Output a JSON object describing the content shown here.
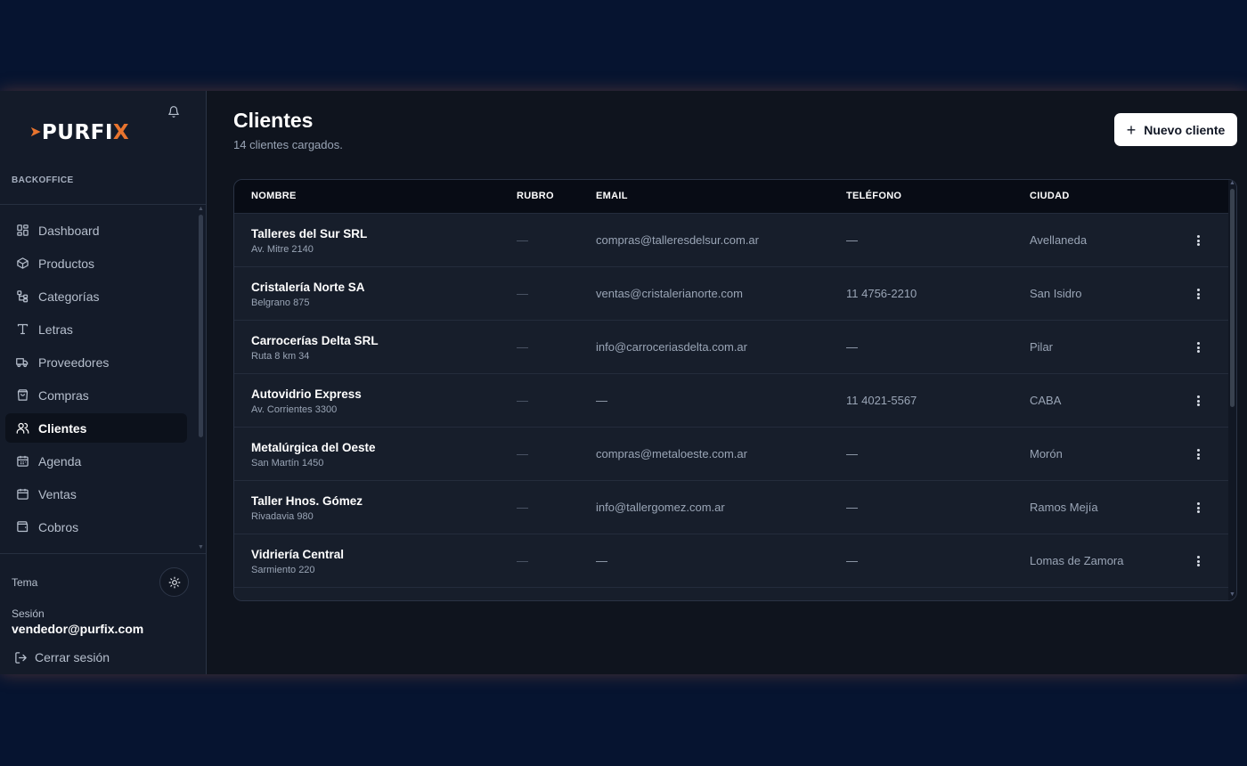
{
  "sidebar": {
    "logo": {
      "prefix": "PURFI",
      "suffix": "X"
    },
    "brand_subtitle": "BACKOFFICE",
    "items": [
      {
        "label": "Dashboard",
        "icon": "dashboard-icon",
        "active": false
      },
      {
        "label": "Productos",
        "icon": "box-icon",
        "active": false
      },
      {
        "label": "Categorías",
        "icon": "categories-icon",
        "active": false
      },
      {
        "label": "Letras",
        "icon": "type-icon",
        "active": false
      },
      {
        "label": "Proveedores",
        "icon": "truck-icon",
        "active": false
      },
      {
        "label": "Compras",
        "icon": "shopping-bag-icon",
        "active": false
      },
      {
        "label": "Clientes",
        "icon": "users-icon",
        "active": true
      },
      {
        "label": "Agenda",
        "icon": "calendar-icon",
        "active": false
      },
      {
        "label": "Ventas",
        "icon": "calendar-icon",
        "active": false
      },
      {
        "label": "Cobros",
        "icon": "wallet-icon",
        "active": false
      }
    ],
    "theme_label": "Tema",
    "session_label": "Sesión",
    "session_user": "vendedor@purfix.com",
    "logout_label": "Cerrar sesión"
  },
  "header": {
    "title": "Clientes",
    "subtitle": "14 clientes cargados.",
    "new_button_label": "Nuevo cliente"
  },
  "table": {
    "columns": [
      "NOMBRE",
      "RUBRO",
      "EMAIL",
      "TELÉFONO",
      "CIUDAD"
    ],
    "rows": [
      {
        "name": "Talleres del Sur SRL",
        "address": "Av. Mitre 2140",
        "rubro": "—",
        "email": "compras@talleresdelsur.com.ar",
        "phone": "—",
        "city": "Avellaneda"
      },
      {
        "name": "Cristalería Norte SA",
        "address": "Belgrano 875",
        "rubro": "—",
        "email": "ventas@cristalerianorte.com",
        "phone": "11 4756-2210",
        "city": "San Isidro"
      },
      {
        "name": "Carrocerías Delta SRL",
        "address": "Ruta 8 km 34",
        "rubro": "—",
        "email": "info@carroceriasdelta.com.ar",
        "phone": "—",
        "city": "Pilar"
      },
      {
        "name": "Autovidrio Express",
        "address": "Av. Corrientes 3300",
        "rubro": "—",
        "email": "—",
        "phone": "11 4021-5567",
        "city": "CABA"
      },
      {
        "name": "Metalúrgica del Oeste",
        "address": "San Martín 1450",
        "rubro": "—",
        "email": "compras@metaloeste.com.ar",
        "phone": "—",
        "city": "Morón"
      },
      {
        "name": "Taller Hnos. Gómez",
        "address": "Rivadavia 980",
        "rubro": "—",
        "email": "info@tallergomez.com.ar",
        "phone": "—",
        "city": "Ramos Mejía"
      },
      {
        "name": "Vidriería Central",
        "address": "Sarmiento 220",
        "rubro": "—",
        "email": "—",
        "phone": "—",
        "city": "Lomas de Zamora"
      }
    ]
  },
  "colors": {
    "background": "#061430",
    "panel": "#0f141e",
    "sidebar": "#141b29",
    "accent": "#e8742e",
    "button_bg": "#ffffff"
  }
}
